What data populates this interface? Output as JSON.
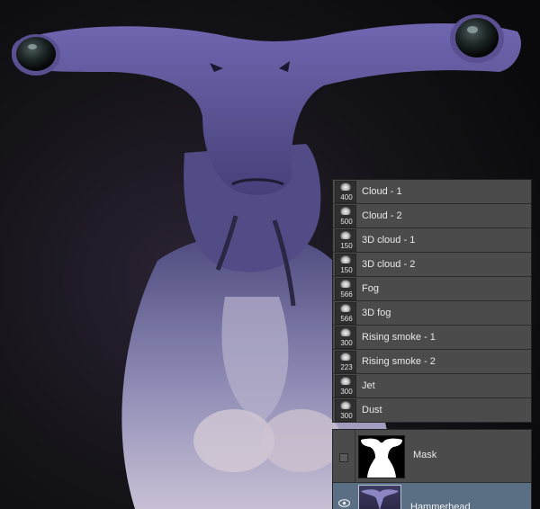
{
  "artwork": {
    "subject": "hammerhead-alien-creature"
  },
  "brush_presets": [
    {
      "size": "400",
      "name": "Cloud - 1",
      "icon": "cloud-brush-icon"
    },
    {
      "size": "500",
      "name": "Cloud - 2",
      "icon": "cloud-brush-icon"
    },
    {
      "size": "150",
      "name": "3D cloud - 1",
      "icon": "cloud-brush-icon"
    },
    {
      "size": "150",
      "name": "3D cloud - 2",
      "icon": "cloud-brush-icon"
    },
    {
      "size": "566",
      "name": "Fog",
      "icon": "fog-brush-icon"
    },
    {
      "size": "566",
      "name": "3D fog",
      "icon": "fog-brush-icon"
    },
    {
      "size": "300",
      "name": "Rising smoke - 1",
      "icon": "smoke-brush-icon"
    },
    {
      "size": "223",
      "name": "Rising smoke - 2",
      "icon": "smoke-brush-icon"
    },
    {
      "size": "300",
      "name": "Jet",
      "icon": "jet-brush-icon"
    },
    {
      "size": "300",
      "name": "Dust",
      "icon": "dust-brush-icon"
    }
  ],
  "layers": {
    "mask": {
      "label": "Mask",
      "visible": false
    },
    "main": {
      "label": "Hammerhead",
      "selected": true,
      "visible": true
    }
  },
  "colors": {
    "panel": "#4b4b4b",
    "selected_layer": "#5a6e84",
    "creature": "#6b63a8"
  }
}
